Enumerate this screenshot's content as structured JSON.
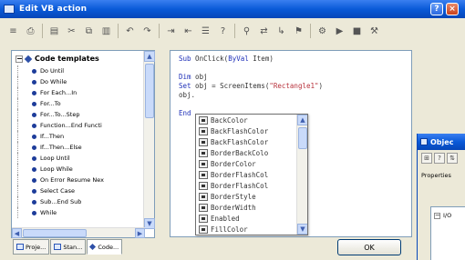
{
  "window": {
    "title": "Edit VB action",
    "help_label": "?",
    "close_label": "×"
  },
  "toolbar": {
    "buttons": [
      {
        "name": "comment-icon",
        "glyph": "≡"
      },
      {
        "name": "print-icon",
        "glyph": "⎙"
      },
      {
        "name": "preview-icon",
        "glyph": "▤"
      },
      {
        "name": "cut-icon",
        "glyph": "✂"
      },
      {
        "name": "copy-icon",
        "glyph": "⧉"
      },
      {
        "name": "paste-icon",
        "glyph": "▥"
      },
      {
        "name": "undo-icon",
        "glyph": "↶"
      },
      {
        "name": "redo-icon",
        "glyph": "↷"
      },
      {
        "name": "indent-icon",
        "glyph": "⇥"
      },
      {
        "name": "outdent-icon",
        "glyph": "⇤"
      },
      {
        "name": "align-icon",
        "glyph": "☰"
      },
      {
        "name": "help-icon",
        "glyph": "?"
      },
      {
        "name": "find-icon",
        "glyph": "⚲"
      },
      {
        "name": "replace-icon",
        "glyph": "⇄"
      },
      {
        "name": "goto-icon",
        "glyph": "↳"
      },
      {
        "name": "bookmark-icon",
        "glyph": "⚑"
      },
      {
        "name": "compile-icon",
        "glyph": "⚙"
      },
      {
        "name": "run-icon",
        "glyph": "▶"
      },
      {
        "name": "stop-icon",
        "glyph": "■"
      },
      {
        "name": "settings-icon",
        "glyph": "⚒"
      }
    ]
  },
  "tree": {
    "root_label": "Code templates",
    "expander": "−",
    "items": [
      "Do Until",
      "Do While",
      "For Each...In",
      "For...To",
      "For...To...Step",
      "Function...End Functi",
      "If...Then",
      "If...Then...Else",
      "Loop Until",
      "Loop While",
      "On Error Resume Nex",
      "Select Case",
      "Sub...End Sub",
      "While"
    ]
  },
  "tabs": [
    {
      "label": "Proje...",
      "icon": "window"
    },
    {
      "label": "Stan...",
      "icon": "window"
    },
    {
      "label": "Code...",
      "icon": "diamond",
      "active": true
    }
  ],
  "editor": {
    "lines": [
      [
        {
          "t": "Sub",
          "c": "kw"
        },
        {
          "t": " OnClick(",
          "c": "plain"
        },
        {
          "t": "ByVal",
          "c": "kw"
        },
        {
          "t": " Item)",
          "c": "plain"
        }
      ],
      [
        {
          "t": "",
          "c": "plain"
        }
      ],
      [
        {
          "t": "Dim",
          "c": "kw"
        },
        {
          "t": " obj",
          "c": "plain"
        }
      ],
      [
        {
          "t": "Set",
          "c": "kw"
        },
        {
          "t": " obj = ScreenItems(",
          "c": "plain"
        },
        {
          "t": "\"Rectangle1\"",
          "c": "str"
        },
        {
          "t": ")",
          "c": "plain"
        }
      ],
      [
        {
          "t": "obj.",
          "c": "plain"
        }
      ],
      [
        {
          "t": "",
          "c": "plain"
        }
      ],
      [
        {
          "t": "End",
          "c": "kw"
        }
      ]
    ]
  },
  "autocomplete": {
    "items": [
      "BackColor",
      "BackFlashColor",
      "BackFlashColor",
      "BorderBackColo",
      "BorderColor",
      "BorderFlashCol",
      "BorderFlashCol",
      "BorderStyle",
      "BorderWidth",
      "Enabled",
      "FillColor"
    ]
  },
  "ok_button": {
    "label": "OK"
  },
  "object_window": {
    "title": "Objec",
    "properties_label": "Properties",
    "tree_label": "I/O"
  }
}
